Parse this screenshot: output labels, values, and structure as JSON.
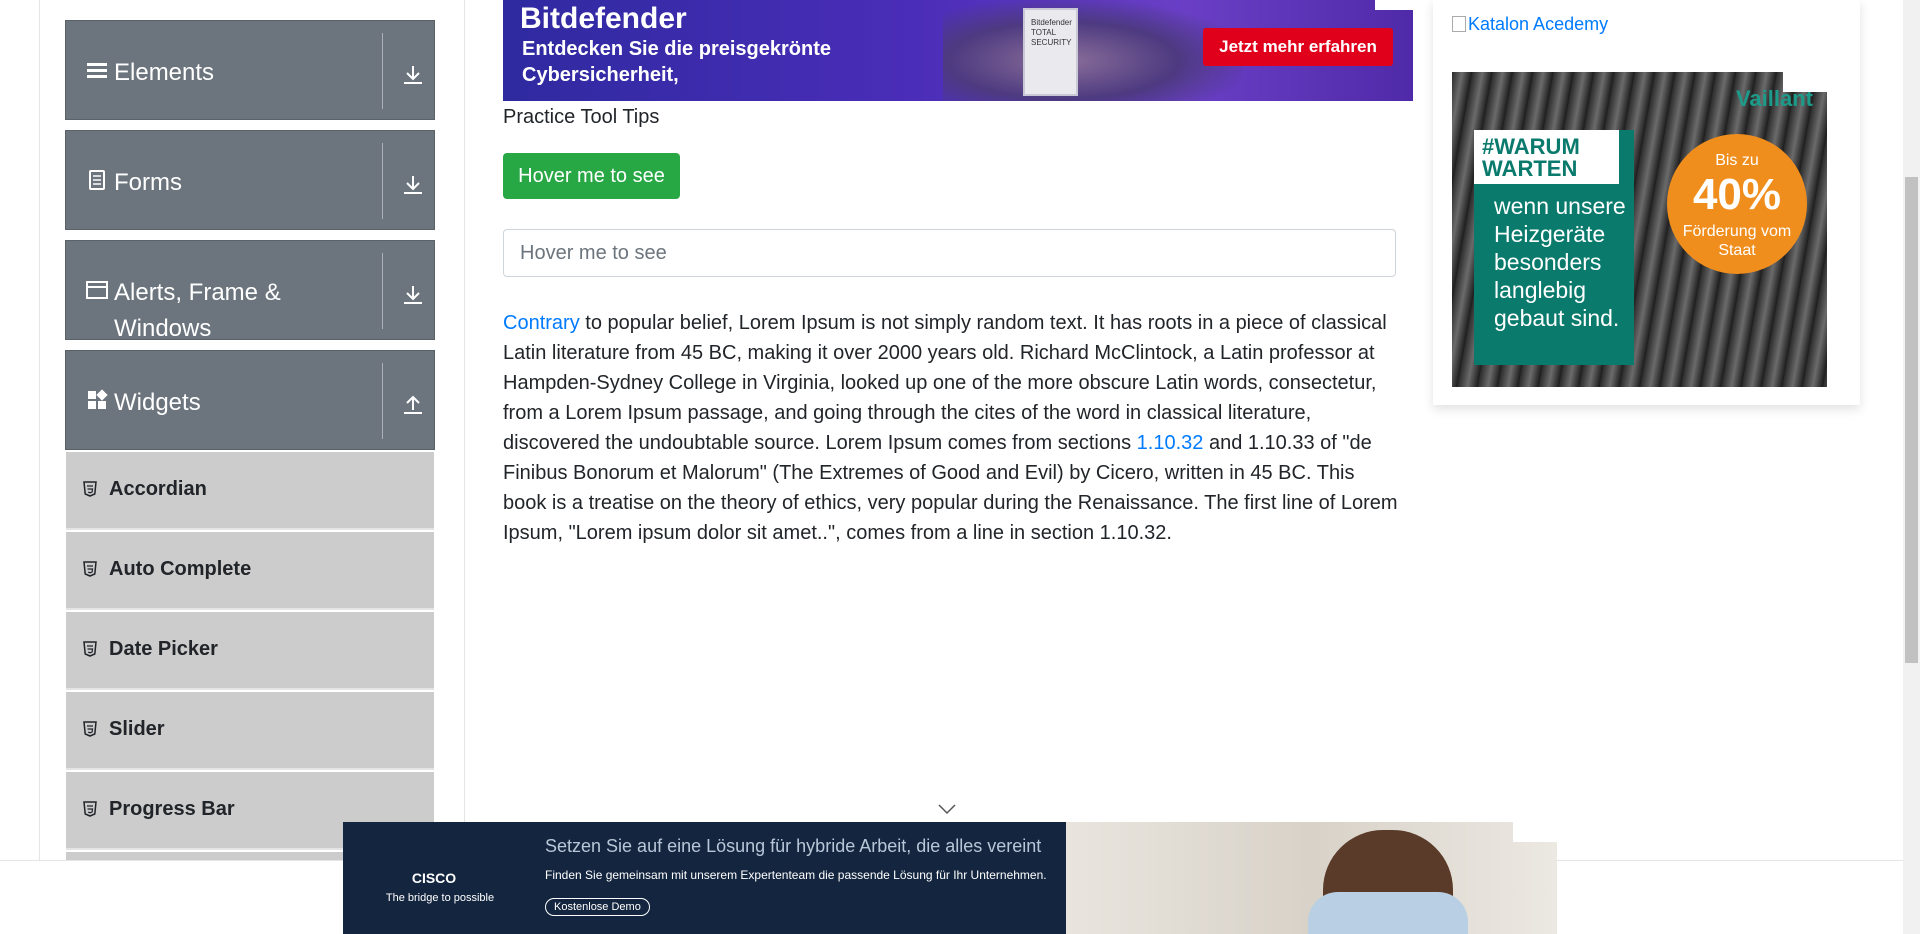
{
  "sidebar": {
    "groups": [
      {
        "title": "Elements",
        "icon": "list-icon",
        "arrow": "download-icon"
      },
      {
        "title": "Forms",
        "icon": "document-icon",
        "arrow": "download-icon"
      },
      {
        "title": "Alerts, Frame & Windows",
        "icon": "window-icon",
        "arrow": "download-icon"
      },
      {
        "title": "Widgets",
        "icon": "widgets-icon",
        "arrow": "upload-icon"
      }
    ],
    "items": [
      {
        "label": "Accordian",
        "icon": "html5-icon"
      },
      {
        "label": "Auto Complete",
        "icon": "html5-icon"
      },
      {
        "label": "Date Picker",
        "icon": "html5-icon"
      },
      {
        "label": "Slider",
        "icon": "html5-icon"
      },
      {
        "label": "Progress Bar",
        "icon": "html5-icon"
      }
    ]
  },
  "ad_top": {
    "brand": "Bitdefender",
    "copy": "Entdecken Sie die preisgekrönte Cybersicherheit,",
    "cta": "Jetzt mehr erfahren",
    "box_text": "Bitdefender TOTAL SECURITY"
  },
  "main": {
    "title": "Practice Tool Tips",
    "button_label": "Hover me to see",
    "input_placeholder": "Hover me to see",
    "para": {
      "link1": "Contrary",
      "text1": " to popular belief, Lorem Ipsum is not simply random text. It has roots in a piece of classical Latin literature from 45 BC, making it over 2000 years old. Richard McClintock, a Latin professor at Hampden-Sydney College in Virginia, looked up one of the more obscure Latin words, consectetur, from a Lorem Ipsum passage, and going through the cites of the word in classical literature, discovered the undoubtable source. Lorem Ipsum comes from sections ",
      "link2": "1.10.32",
      "text2": " and 1.10.33 of \"de Finibus Bonorum et Malorum\" (The Extremes of Good and Evil) by Cicero, written in 45 BC. This book is a treatise on the theory of ethics, very popular during the Renaissance. The first line of Lorem Ipsum, \"Lorem ipsum dolor sit amet..\", comes from a line in section 1.10.32."
    }
  },
  "right": {
    "katalon": "Katalon Acedemy",
    "ad": {
      "brand": "Vaillant",
      "hashtag": "#WARUM WARTEN",
      "text": "wenn unsere Heizgeräte besonders langlebig gebaut sind.",
      "circle_top": "Bis zu",
      "circle_value": "40%",
      "circle_bottom": "Förderung vom Staat"
    }
  },
  "ad_bottom": {
    "logo": "CISCO",
    "tagline": "The bridge to possible",
    "headline": "Setzen Sie auf eine Lösung für hybride Arbeit, die alles vereint",
    "sub": "Finden Sie gemeinsam mit unserem Expertenteam die passende Lösung für Ihr Unternehmen.",
    "demo": "Kostenlose Demo"
  },
  "colors": {
    "sidebar_header": "#6c757d",
    "sidebar_item": "#cccccc",
    "button_green": "#28a745",
    "link_blue": "#007bff"
  }
}
